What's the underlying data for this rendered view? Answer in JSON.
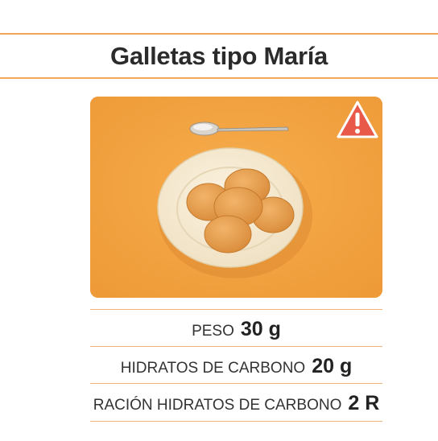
{
  "title": "Galletas tipo María",
  "image": {
    "subject": "plate-with-biscuits",
    "warning_icon": "warning-triangle-icon",
    "background_color": "#f5a544",
    "warning_color": "#e8594a"
  },
  "nutrition": [
    {
      "label": "PESO",
      "value": "30 g"
    },
    {
      "label": "HIDRATOS DE CARBONO",
      "value": "20 g"
    },
    {
      "label": "RACIÓN HIDRATOS DE CARBONO",
      "value": "2 R"
    }
  ],
  "colors": {
    "accent": "#f2a65a",
    "text": "#2b2b2b"
  }
}
